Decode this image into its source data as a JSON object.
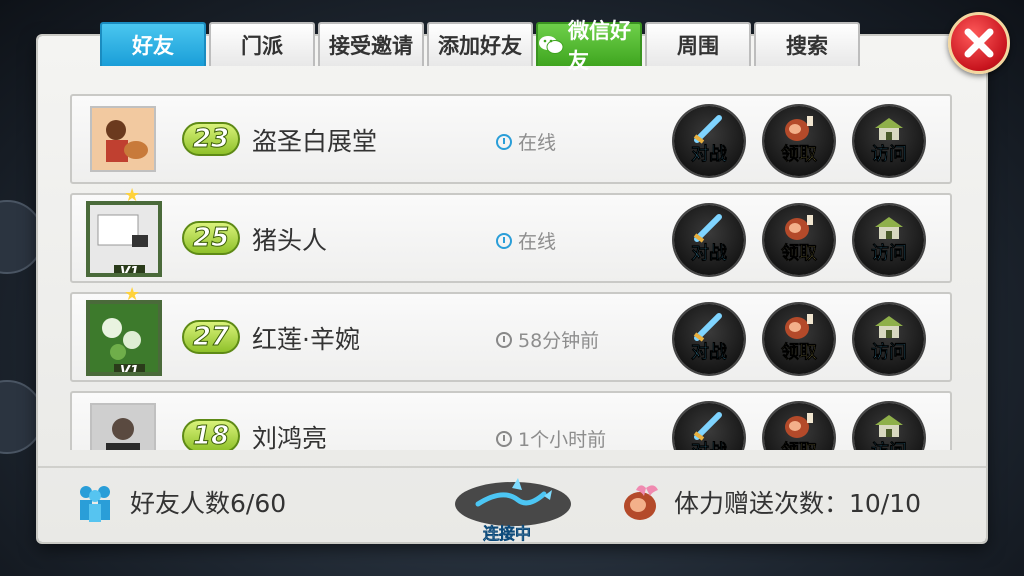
{
  "tabs": [
    {
      "label": "好友",
      "active": true
    },
    {
      "label": "门派",
      "active": false
    },
    {
      "label": "接受邀请",
      "active": false
    },
    {
      "label": "添加好友",
      "active": false
    },
    {
      "label": "微信好友",
      "active": false,
      "icon": "wechat-icon"
    },
    {
      "label": "周围",
      "active": false
    },
    {
      "label": "搜索",
      "active": false
    }
  ],
  "close_icon": "close-icon",
  "friends": [
    {
      "level": "23",
      "name": "盗圣白展堂",
      "status": "在线",
      "online": true,
      "avatar": "avatar-icon",
      "vip": ""
    },
    {
      "level": "25",
      "name": "猪头人",
      "status": "在线",
      "online": true,
      "avatar": "avatar-icon",
      "vip": "V1"
    },
    {
      "level": "27",
      "name": "红莲·辛婉",
      "status": "58分钟前",
      "online": false,
      "avatar": "avatar-icon",
      "vip": "V1"
    },
    {
      "level": "18",
      "name": "刘鸿亮",
      "status": "1个小时前",
      "online": false,
      "avatar": "avatar-icon",
      "vip": ""
    }
  ],
  "actions": {
    "battle": "对战",
    "claim": "领取",
    "visit": "访问"
  },
  "footer": {
    "friend_count": "好友人数6/60",
    "connection": "连接中",
    "gift_count": "体力赠送次数：10/10"
  }
}
